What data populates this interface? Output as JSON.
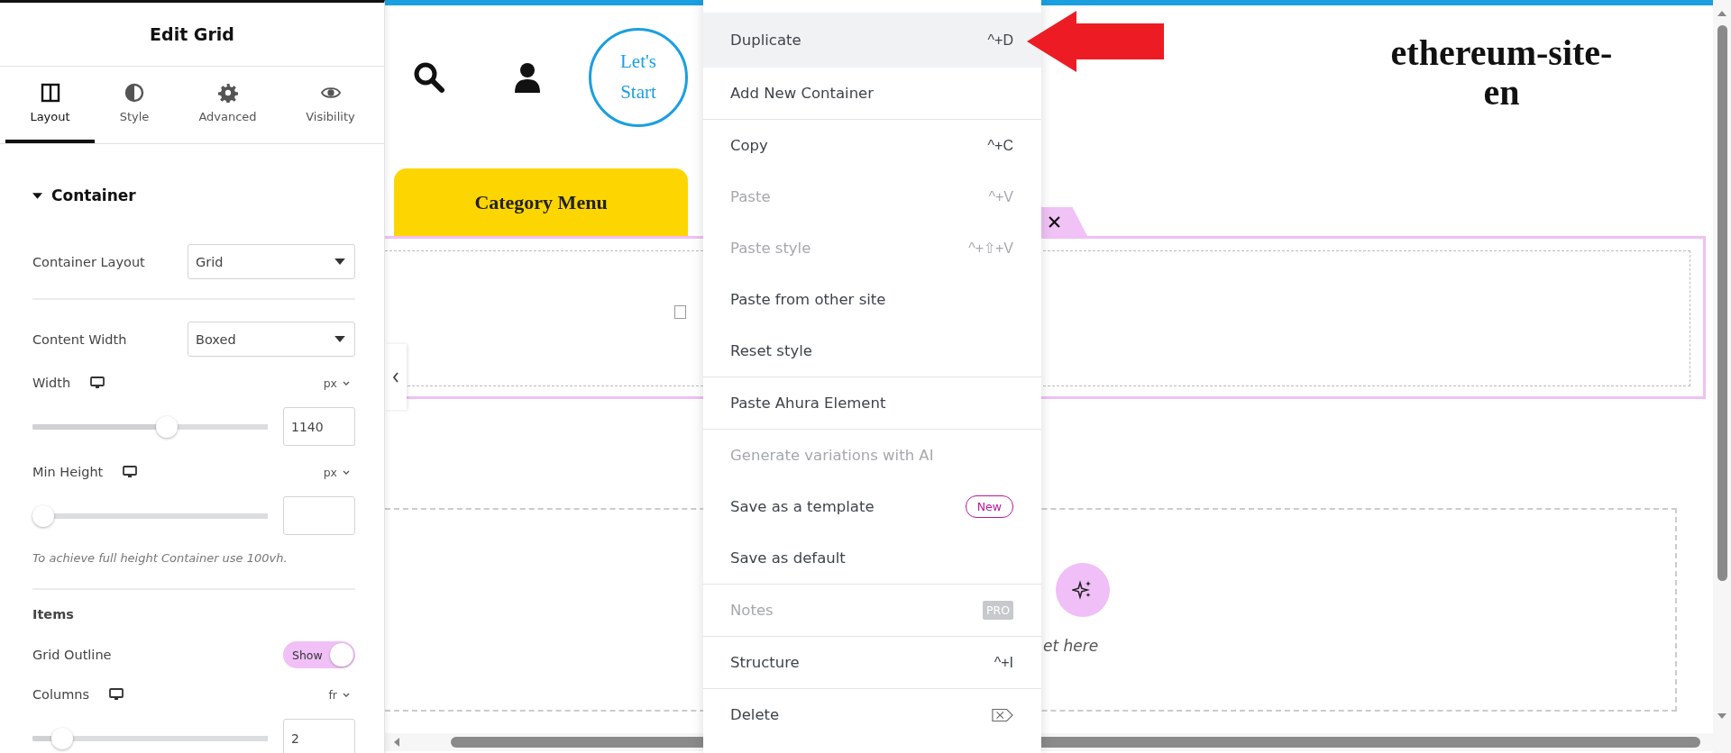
{
  "panel": {
    "title": "Edit Grid",
    "tabs": [
      {
        "label": "Layout",
        "selected": true,
        "kind": "layout"
      },
      {
        "label": "Style",
        "selected": false,
        "kind": "style"
      },
      {
        "label": "Advanced",
        "selected": false,
        "kind": "advanced"
      },
      {
        "label": "Visibility",
        "selected": false,
        "kind": "visibility"
      }
    ],
    "section": {
      "title": "Container"
    },
    "controls": [
      {
        "kind": "select",
        "label": "Container Layout",
        "value": "Grid"
      },
      {
        "kind": "divider"
      },
      {
        "kind": "select",
        "label": "Content Width",
        "value": "Boxed"
      },
      {
        "kind": "slider",
        "label": "Width",
        "unit": "px",
        "level": 0.58,
        "value": "1140"
      },
      {
        "kind": "slider",
        "label": "Min Height",
        "unit": "px",
        "level": 0
      },
      {
        "kind": "note",
        "text": "To achieve full height Container use 100vh."
      },
      {
        "kind": "divider"
      },
      {
        "kind": "heading",
        "text": "Items"
      },
      {
        "kind": "toggle",
        "label": "Grid Outline",
        "on": true,
        "state_label": "Show"
      },
      {
        "kind": "slider",
        "label": "Columns",
        "unit": "fr",
        "level": 0.09,
        "value": "2"
      }
    ]
  },
  "canvas": {
    "button": "Let's Start",
    "site_title": "ethereum-site-en",
    "category_menu": "Category Menu",
    "drop_hint": "et here"
  },
  "context_menu": {
    "groups": [
      {
        "items": [
          {
            "label": "Duplicate",
            "shortcut": "^+D",
            "highlighted": true,
            "disabled": false
          },
          {
            "label": "Add New Container",
            "highlighted": false,
            "disabled": false
          }
        ]
      },
      {
        "items": [
          {
            "label": "Copy",
            "shortcut": "^+C",
            "highlighted": false,
            "disabled": false
          },
          {
            "label": "Paste",
            "shortcut": "^+V",
            "highlighted": false,
            "disabled": true
          },
          {
            "label": "Paste style",
            "shortcut": "^+⇧+V",
            "highlighted": false,
            "disabled": true
          },
          {
            "label": "Paste from other site",
            "highlighted": false,
            "disabled": false
          },
          {
            "label": "Reset style",
            "highlighted": false,
            "disabled": false
          }
        ]
      },
      {
        "items": [
          {
            "label": "Paste Ahura Element",
            "highlighted": false,
            "disabled": false
          }
        ]
      },
      {
        "items": [
          {
            "label": "Generate variations with AI",
            "highlighted": false,
            "disabled": true
          },
          {
            "label": "Save as a template",
            "badge": {
              "kind": "new",
              "text": "New"
            },
            "highlighted": false,
            "disabled": false
          },
          {
            "label": "Save as default",
            "highlighted": false,
            "disabled": false
          }
        ]
      },
      {
        "items": [
          {
            "label": "Notes",
            "badge": {
              "kind": "pro",
              "text": "PRO"
            },
            "highlighted": false,
            "disabled": true
          }
        ]
      },
      {
        "items": [
          {
            "label": "Structure",
            "shortcut": "^+I",
            "highlighted": false,
            "disabled": false
          }
        ]
      },
      {
        "items": [
          {
            "label": "Delete",
            "key_icon": true,
            "highlighted": false,
            "disabled": false
          }
        ]
      }
    ]
  }
}
